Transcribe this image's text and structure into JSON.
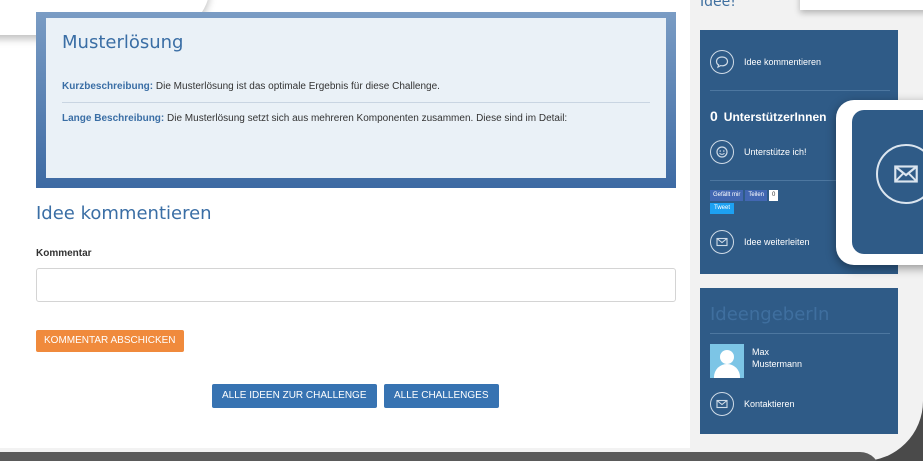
{
  "sidebar_heading": "Idee!",
  "solution": {
    "title": "Musterlösung",
    "short_label": "Kurzbeschreibung:",
    "short_text": " Die Musterlösung ist das optimale Ergebnis für diese Challenge.",
    "long_label": "Lange Beschreibung:",
    "long_text": " Die Musterlösung setzt sich aus mehreren Komponenten zusammen. Diese sind im Detail:"
  },
  "comment": {
    "heading": "Idee kommentieren",
    "field_label": "Kommentar",
    "field_value": "",
    "submit_label": "KOMMENTAR ABSCHICKEN"
  },
  "buttons": {
    "all_ideas": "ALLE IDEEN ZUR CHALLENGE",
    "all_challenges": "ALLE CHALLENGES"
  },
  "sidebar": {
    "comment_action": "Idee kommentieren",
    "supporters_count": "0",
    "supporters_label": "UnterstützerInnen",
    "support_action": "Unterstütze ich!",
    "fb_like": "Gefällt mir",
    "fb_share": "Teilen",
    "fb_count": "0",
    "tweet": "Tweet",
    "forward_action": "Idee weiterleiten"
  },
  "ideengeber": {
    "heading": "IdeengeberIn",
    "first_name": "Max",
    "last_name": "Mustermann",
    "contact_action": "Kontaktieren"
  },
  "icons": {
    "comment": "speech-bubble-icon",
    "support": "smiley-icon",
    "forward": "envelope-icon",
    "contact": "envelope-icon",
    "zoom": "envelope-icon"
  },
  "colors": {
    "brand_blue": "#3a6ea5",
    "sidebar_bg": "#2f5b87",
    "accent_orange": "#f08a3c",
    "button_blue": "#3773b2"
  }
}
